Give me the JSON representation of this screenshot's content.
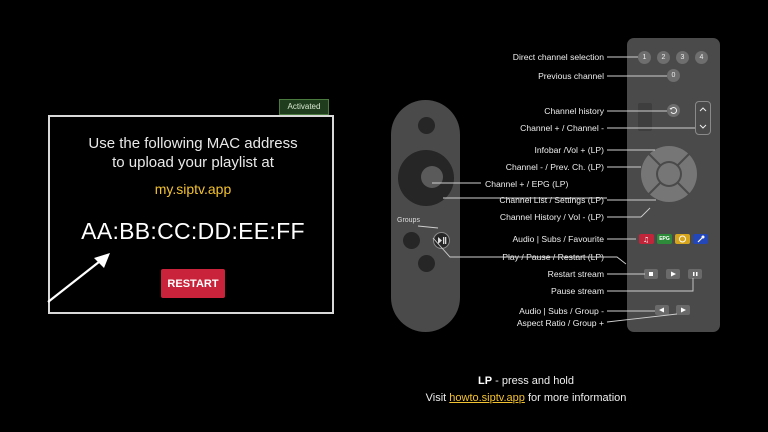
{
  "panel": {
    "badge": "Activated",
    "instruction_line1": "Use the following MAC address",
    "instruction_line2": "to upload your playlist at",
    "url": "my.siptv.app",
    "mac": "AA:BB:CC:DD:EE:FF",
    "restart_label": "RESTART"
  },
  "small_remote": {
    "groups_label": "Groups"
  },
  "remote_labels": {
    "direct_channel": "Direct channel selection",
    "previous_channel": "Previous channel",
    "channel_history": "Channel history",
    "channel_plus_minus": "Channel + / Channel -",
    "infobar_vol": "Infobar /Vol + (LP)",
    "channel_minus_prev": "Channel - / Prev. Ch. (LP)",
    "channel_plus_epg": "Channel + / EPG (LP)",
    "channel_list_settings": "Channel List / Settings (LP)",
    "channel_history_vol": "Channel History / Vol - (LP)",
    "audio_subs_fav": "Audio | Subs / Favourite",
    "play_pause_restart": "Play / Pause / Restart (LP)",
    "restart_stream": "Restart stream",
    "pause_stream": "Pause stream",
    "audio_subs_group": "Audio | Subs / Group -",
    "aspect_ratio_group": "Aspect Ratio / Group +"
  },
  "remote_buttons": {
    "digits": [
      "1",
      "2",
      "3",
      "4"
    ],
    "zero": "0",
    "epg": "EPG"
  },
  "colors": {
    "accent_yellow": "#f2c230",
    "restart_red": "#c8233a",
    "color_red": "#c0253a",
    "color_green": "#2e8b3a",
    "color_yellow": "#d6a51c",
    "color_blue": "#2346b8"
  },
  "info": {
    "lp_bold": "LP",
    "lp_text": " - press and hold",
    "visit_prefix": "Visit ",
    "visit_link": "howto.siptv.app",
    "visit_suffix": " for more information"
  }
}
